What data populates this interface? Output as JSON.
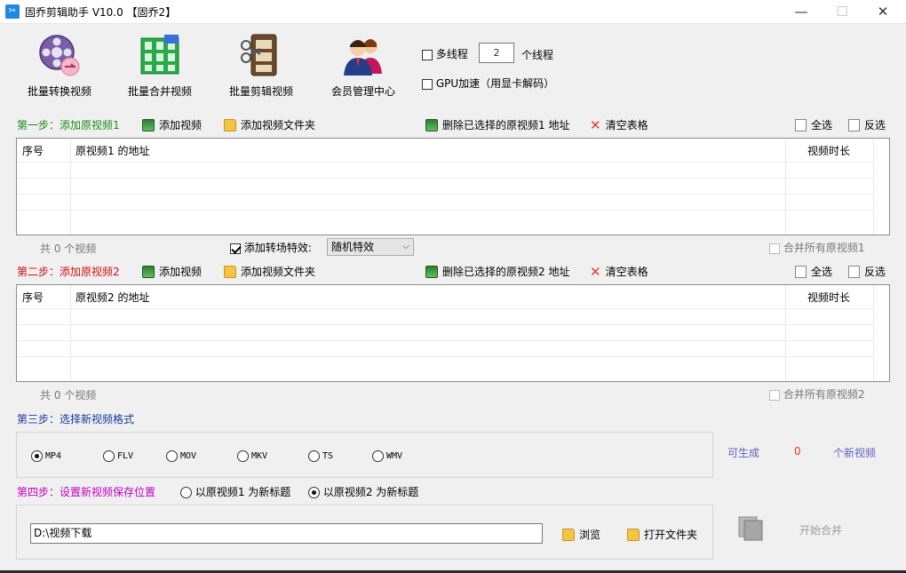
{
  "window": {
    "title": "固乔剪辑助手 V10.0  【固乔2】",
    "icon_text": "✂",
    "minimize": "—",
    "maximize": "☐",
    "close": "✕"
  },
  "toolbar": {
    "tools": [
      {
        "label": "批量转换视频",
        "icon": "film-reel-convert-icon"
      },
      {
        "label": "批量合并视频",
        "icon": "film-grid-merge-icon"
      },
      {
        "label": "批量剪辑视频",
        "icon": "film-strip-cut-icon"
      },
      {
        "label": "会员管理中心",
        "icon": "members-icon"
      }
    ],
    "multithread_label": "多线程",
    "thread_count": "2",
    "thread_unit": "个线程",
    "gpu_label": "GPU加速（用显卡解码）"
  },
  "step1": {
    "title": "第一步：添加原视频1",
    "add_video": "添加视频",
    "add_folder": "添加视频文件夹",
    "delete_selected": "删除已选择的原视频1 地址",
    "clear_table": "清空表格",
    "select_all": "全选",
    "invert": "反选",
    "columns": [
      "序号",
      "原视频1 的地址",
      "视频时长"
    ],
    "count": "共 0 个视频",
    "transition_label": "添加转场特效:",
    "transition_value": "随机特效",
    "merge_all": "合并所有原视频1"
  },
  "step2": {
    "title": "第二步：添加原视频2",
    "add_video": "添加视频",
    "add_folder": "添加视频文件夹",
    "delete_selected": "删除已选择的原视频2 地址",
    "clear_table": "清空表格",
    "select_all": "全选",
    "invert": "反选",
    "columns": [
      "序号",
      "原视频2 的地址",
      "视频时长"
    ],
    "count": "共 0 个视频",
    "merge_all": "合并所有原视频2"
  },
  "step3": {
    "title": "第三步：选择新视频格式",
    "formats": [
      "MP4",
      "FLV",
      "MOV",
      "MKV",
      "TS",
      "WMV"
    ],
    "selected_format": "MP4",
    "gen_prefix": "可生成",
    "gen_count": "0",
    "gen_suffix": "个新视频"
  },
  "step4": {
    "title": "第四步：设置新视频保存位置",
    "option1": "以原视频1 为新标题",
    "option2": "以原视频2 为新标题",
    "selected_option": "option2",
    "path": "D:\\视频下载",
    "browse": "浏览",
    "open_folder": "打开文件夹",
    "start": "开始合并"
  },
  "colors": {
    "step1": "#1a8a1a",
    "step2": "#d01010",
    "step3": "#1a3a9a",
    "step4": "#c000c0",
    "generate_text": "#6060c0",
    "generate_count": "#e53935"
  }
}
